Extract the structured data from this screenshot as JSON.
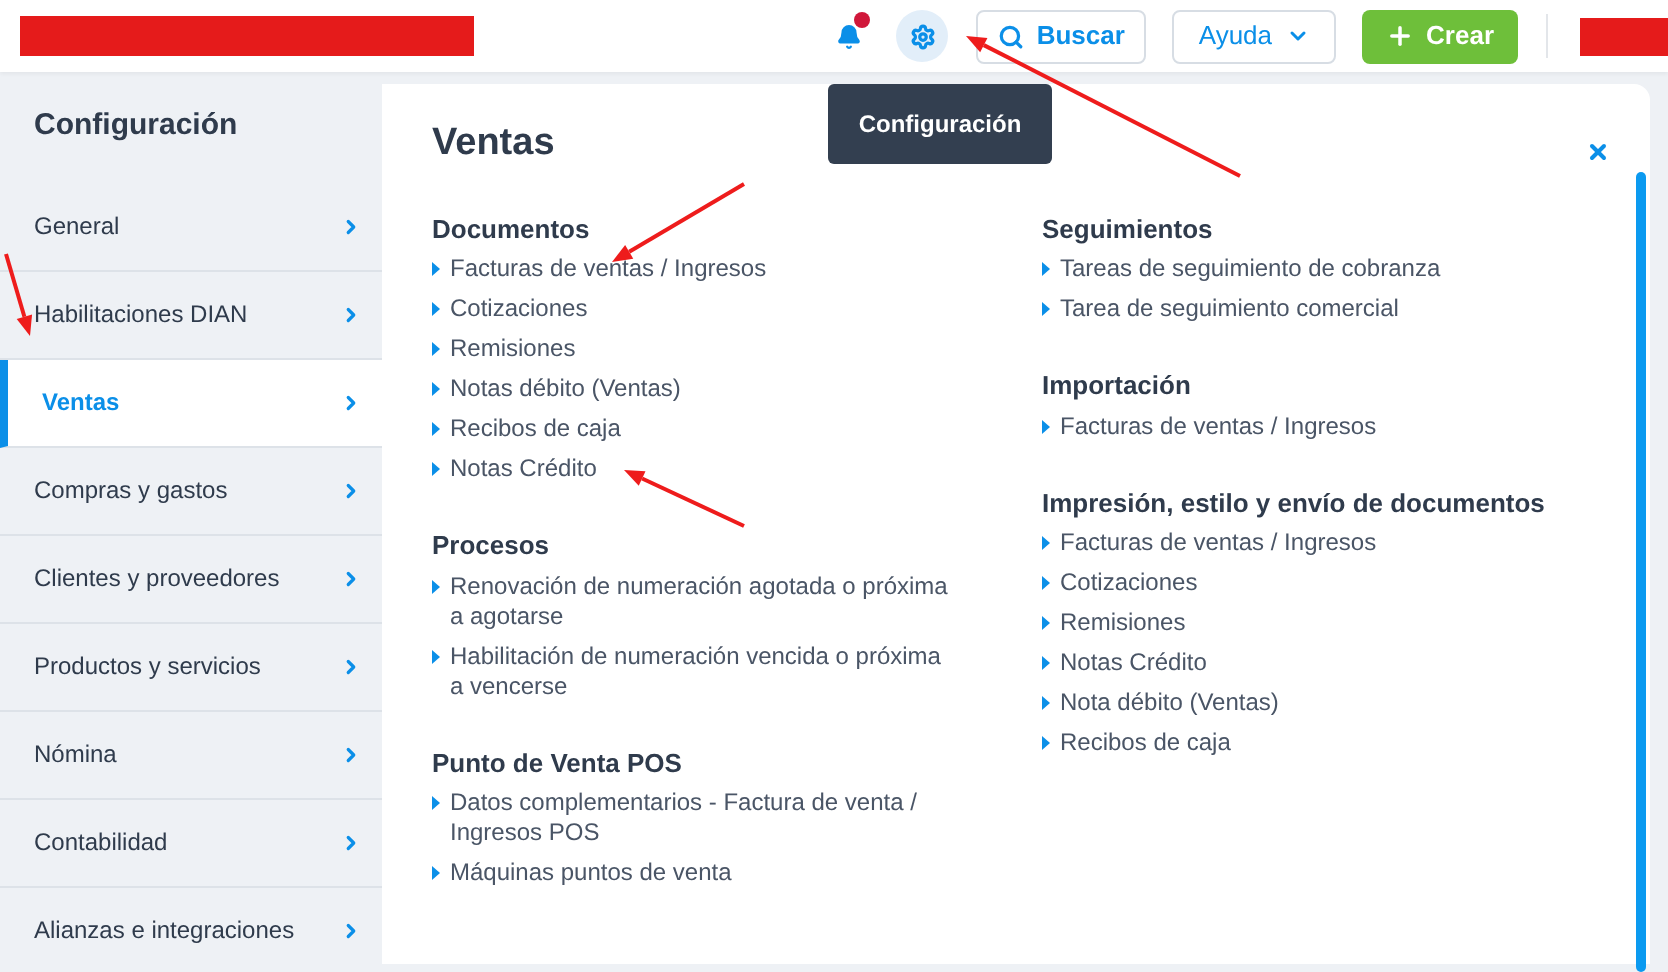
{
  "topbar": {
    "notifications": {
      "unread": true
    },
    "settings": {
      "selected": true,
      "tooltip": "Configuración"
    },
    "search_button": "Buscar",
    "help_button": "Ayuda",
    "create_button": "Crear"
  },
  "sidebar": {
    "title": "Configuración",
    "items": [
      {
        "label": "General",
        "selected": false
      },
      {
        "label": "Habilitaciones DIAN",
        "selected": false
      },
      {
        "label": "Ventas",
        "selected": true
      },
      {
        "label": "Compras y gastos",
        "selected": false
      },
      {
        "label": "Clientes y proveedores",
        "selected": false
      },
      {
        "label": "Productos y servicios",
        "selected": false
      },
      {
        "label": "Nómina",
        "selected": false
      },
      {
        "label": "Contabilidad",
        "selected": false
      },
      {
        "label": "Alianzas e integraciones",
        "selected": false
      }
    ]
  },
  "panel": {
    "title": "Ventas",
    "columns": [
      [
        {
          "heading": "Documentos",
          "links": [
            "Facturas de ventas / Ingresos",
            "Cotizaciones",
            "Remisiones",
            "Notas débito (Ventas)",
            "Recibos de caja",
            "Notas Crédito"
          ]
        },
        {
          "heading": "Procesos",
          "links": [
            "Renovación de numeración agotada o próxima a agotarse",
            "Habilitación de numeración vencida o próxima a vencerse"
          ]
        },
        {
          "heading": "Punto de Venta POS",
          "links": [
            "Datos complementarios - Factura de venta / Ingresos POS",
            "Máquinas puntos de venta"
          ]
        }
      ],
      [
        {
          "heading": "Seguimientos",
          "links": [
            "Tareas de seguimiento de cobranza",
            "Tarea de seguimiento comercial"
          ]
        },
        {
          "heading": "Importación",
          "links": [
            "Facturas de ventas / Ingresos"
          ]
        },
        {
          "heading": "Impresión, estilo y envío de documentos",
          "links": [
            "Facturas de ventas / Ingresos",
            "Cotizaciones",
            "Remisiones",
            "Notas Crédito",
            "Nota débito (Ventas)",
            "Recibos de caja"
          ]
        }
      ]
    ]
  }
}
